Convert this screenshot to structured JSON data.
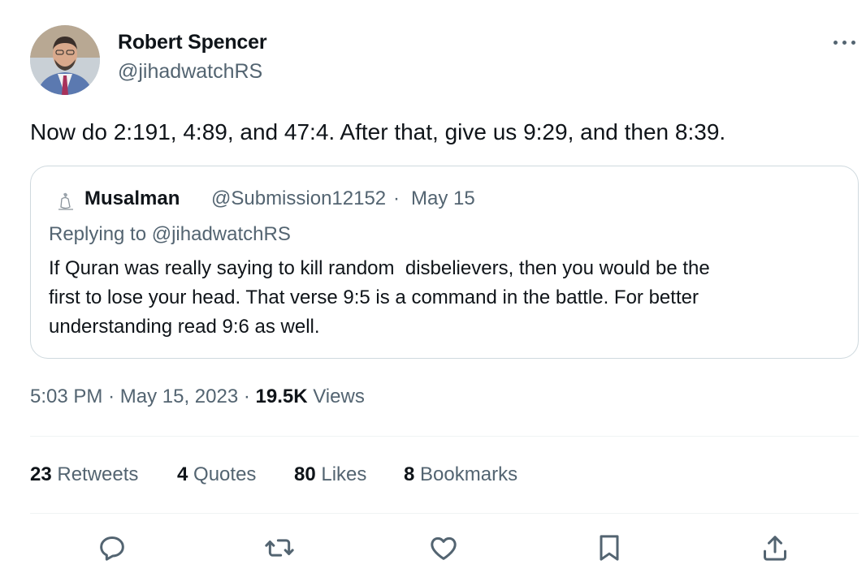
{
  "author": {
    "name": "Robert Spencer",
    "handle": "@jihadwatchRS"
  },
  "tweet": {
    "text": "Now do 2:191, 4:89, and 47:4. After that, give us 9:29, and then 8:39."
  },
  "quote": {
    "name": "Musalman",
    "handle": "@Submission12152",
    "separator": "·",
    "date": "May 15",
    "replying_to": "Replying to @jihadwatchRS",
    "body_lines": [
      "If Quran was really saying to kill random  disbelievers, then you would be the",
      "first to lose your head. That verse 9:5 is a command in the battle. For better",
      "understanding read 9:6 as well."
    ]
  },
  "meta": {
    "time": "5:03 PM",
    "sep1": "·",
    "date": "May 15, 2023",
    "sep2": "·",
    "views_count": "19.5K",
    "views_label": "Views"
  },
  "stats": [
    {
      "count": "23",
      "label": "Retweets"
    },
    {
      "count": "4",
      "label": "Quotes"
    },
    {
      "count": "80",
      "label": "Likes"
    },
    {
      "count": "8",
      "label": "Bookmarks"
    }
  ],
  "actions": [
    "reply-icon",
    "retweet-icon",
    "like-icon",
    "bookmark-icon",
    "share-icon"
  ],
  "colors": {
    "text": "#0f1419",
    "secondary": "#536471",
    "border": "#cfd9de",
    "divider": "#eff3f4"
  }
}
